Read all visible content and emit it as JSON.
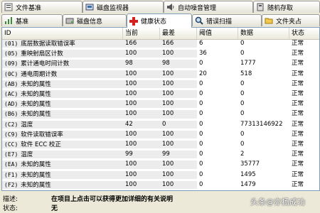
{
  "tabs_row1": [
    {
      "label": "文件基准",
      "icon": "file-benchmark-icon"
    },
    {
      "label": "磁盘监视器",
      "icon": "disk-monitor-icon"
    },
    {
      "label": "自动噪音管理",
      "icon": "noise-management-icon"
    },
    {
      "label": "随机存取",
      "icon": "random-access-icon"
    }
  ],
  "tabs_row2": [
    {
      "label": "基准",
      "icon": "benchmark-icon"
    },
    {
      "label": "磁盘信息",
      "icon": "disk-info-icon"
    },
    {
      "label": "健康状态",
      "icon": "health-cross-icon",
      "active": true
    },
    {
      "label": "错误扫描",
      "icon": "magnifier-icon"
    },
    {
      "label": "文件夹占",
      "icon": "folder-icon"
    }
  ],
  "table": {
    "columns": [
      "ID",
      "当前",
      "最差",
      "阈值",
      "数据",
      "状态"
    ],
    "rows": [
      {
        "id": "(01)",
        "name": "底层数据读取错误率",
        "current": "166",
        "worst": "166",
        "threshold": "6",
        "data": "0",
        "status": "正常"
      },
      {
        "id": "(05)",
        "name": "重映射扇区计数",
        "current": "100",
        "worst": "100",
        "threshold": "36",
        "data": "0",
        "status": "正常"
      },
      {
        "id": "(09)",
        "name": "累计通电时间计数",
        "current": "98",
        "worst": "98",
        "threshold": "0",
        "data": "1777",
        "status": "正常"
      },
      {
        "id": "(0C)",
        "name": "通电周期计数",
        "current": "100",
        "worst": "100",
        "threshold": "20",
        "data": "518",
        "status": "正常"
      },
      {
        "id": "(AB)",
        "name": "未知的属性",
        "current": "100",
        "worst": "100",
        "threshold": "0",
        "data": "0",
        "status": "正常"
      },
      {
        "id": "(AC)",
        "name": "未知的属性",
        "current": "100",
        "worst": "100",
        "threshold": "0",
        "data": "0",
        "status": "正常"
      },
      {
        "id": "(AD)",
        "name": "未知的属性",
        "current": "100",
        "worst": "100",
        "threshold": "0",
        "data": "0",
        "status": "正常"
      },
      {
        "id": "(B6)",
        "name": "未知的属性",
        "current": "100",
        "worst": "100",
        "threshold": "0",
        "data": "0",
        "status": "正常"
      },
      {
        "id": "(C2)",
        "name": "温度",
        "current": "42",
        "worst": "0",
        "threshold": "0",
        "data": "77313146922",
        "status": "正常"
      },
      {
        "id": "(C9)",
        "name": "软件读取错误率",
        "current": "100",
        "worst": "100",
        "threshold": "0",
        "data": "0",
        "status": "正常"
      },
      {
        "id": "(CC)",
        "name": "软件 ECC 校正",
        "current": "100",
        "worst": "100",
        "threshold": "0",
        "data": "0",
        "status": "正常"
      },
      {
        "id": "(E7)",
        "name": "温度",
        "current": "99",
        "worst": "99",
        "threshold": "0",
        "data": "2",
        "status": "正常"
      },
      {
        "id": "(EA)",
        "name": "未知的属性",
        "current": "100",
        "worst": "100",
        "threshold": "0",
        "data": "35777",
        "status": "正常"
      },
      {
        "id": "(F1)",
        "name": "未知的属性",
        "current": "100",
        "worst": "100",
        "threshold": "0",
        "data": "1495",
        "status": "正常"
      },
      {
        "id": "(F2)",
        "name": "未知的属性",
        "current": "100",
        "worst": "100",
        "threshold": "0",
        "data": "1479",
        "status": "正常"
      }
    ]
  },
  "footer": {
    "desc_label": "描述:",
    "desc_value": "在项目上点击可以获得更加详细的有关说明",
    "status_label": "状态:",
    "status_value": "无"
  },
  "watermark": "头条@亦扬成功",
  "colors": {
    "panel_border": "#7f9db9",
    "window_bg": "#ece9d8",
    "alt_row": "#ececec"
  }
}
